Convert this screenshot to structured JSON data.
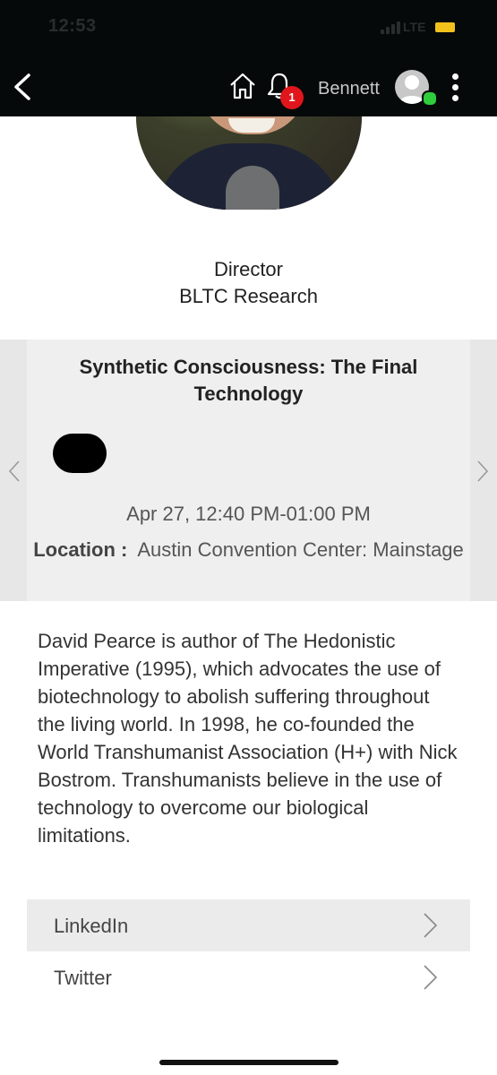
{
  "status_bar": {
    "time": "12:53",
    "network": "LTE"
  },
  "header": {
    "user_name": "Bennett",
    "notification_count": "1"
  },
  "speaker": {
    "role": "Director",
    "organization": "BLTC Research"
  },
  "session": {
    "title": "Synthetic Consciousness: The Final Technology",
    "time": "Apr 27, 12:40 PM-01:00 PM",
    "location_label": "Location :",
    "location_value": "Austin Convention Center: Mainstage"
  },
  "bio": "David Pearce is author of The Hedonistic Imperative (1995), which advocates the use of biotechnology to abolish suffering throughout the living world. In 1998, he co-founded the World Transhumanist Association (H+) with Nick Bostrom. Transhumanists believe in the use of technology to overcome our biological limitations.",
  "links": [
    {
      "label": "LinkedIn"
    },
    {
      "label": "Twitter"
    }
  ],
  "icons": [
    "back-icon",
    "home-icon",
    "bell-icon",
    "avatar",
    "kebab-icon",
    "chevron-left-icon",
    "chevron-right-icon"
  ],
  "colors": {
    "header_bg": "#050909",
    "badge": "#e0161c",
    "online": "#2fcc3c",
    "card_bg": "#efefef"
  }
}
